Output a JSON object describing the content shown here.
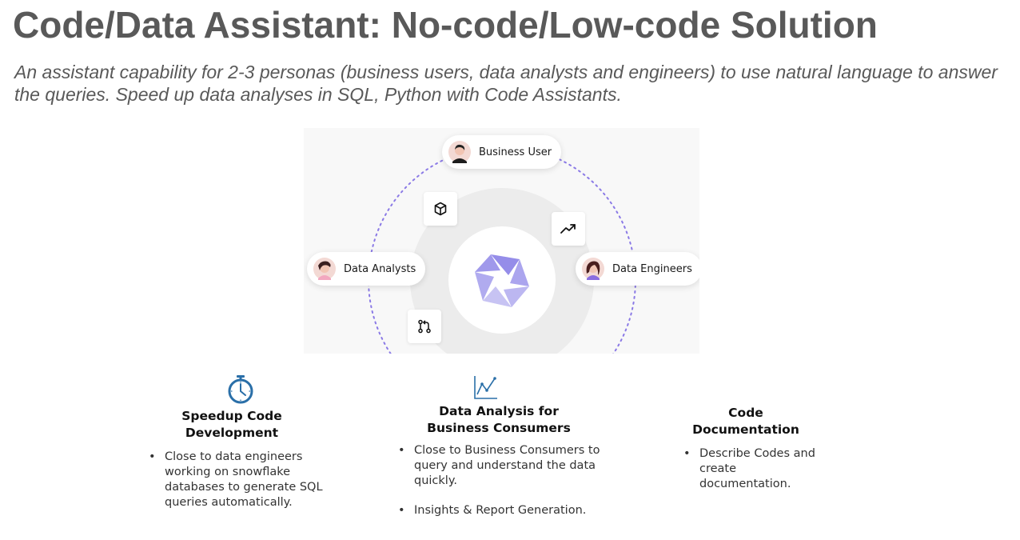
{
  "slide": {
    "title": "Code/Data Assistant: No-code/Low-code Solution",
    "subtitle": "An assistant capability for 2-3 personas (business users, data analysts and engineers) to use natural language to answer the queries. Speed up data analyses in SQL, Python with Code Assistants."
  },
  "diagram": {
    "personas": {
      "business_user": "Business User",
      "data_analysts": "Data Analysts",
      "data_engineers": "Data Engineers"
    },
    "icons": [
      "cube-icon",
      "trend-up-icon",
      "git-pull-request-icon",
      "aperture-logo"
    ],
    "colors": {
      "dotted_ring": "#8b7ae6",
      "logo": "#8f87e8",
      "background": "#f8f8f8"
    }
  },
  "features": {
    "speedup": {
      "heading_line1": "Speedup Code",
      "heading_line2": "Development",
      "bullets": [
        "Close to data engineers working on snowflake databases to generate SQL queries automatically."
      ]
    },
    "analysis": {
      "heading_line1": "Data Analysis for",
      "heading_line2": "Business Consumers",
      "bullets": [
        "Close to Business Consumers to query and understand the data quickly.",
        "Insights & Report Generation."
      ]
    },
    "docs": {
      "heading_line1": "Code",
      "heading_line2": "Documentation",
      "bullets": [
        "Describe Codes and create documentation."
      ]
    },
    "icon_color": "#2a6fa8"
  }
}
